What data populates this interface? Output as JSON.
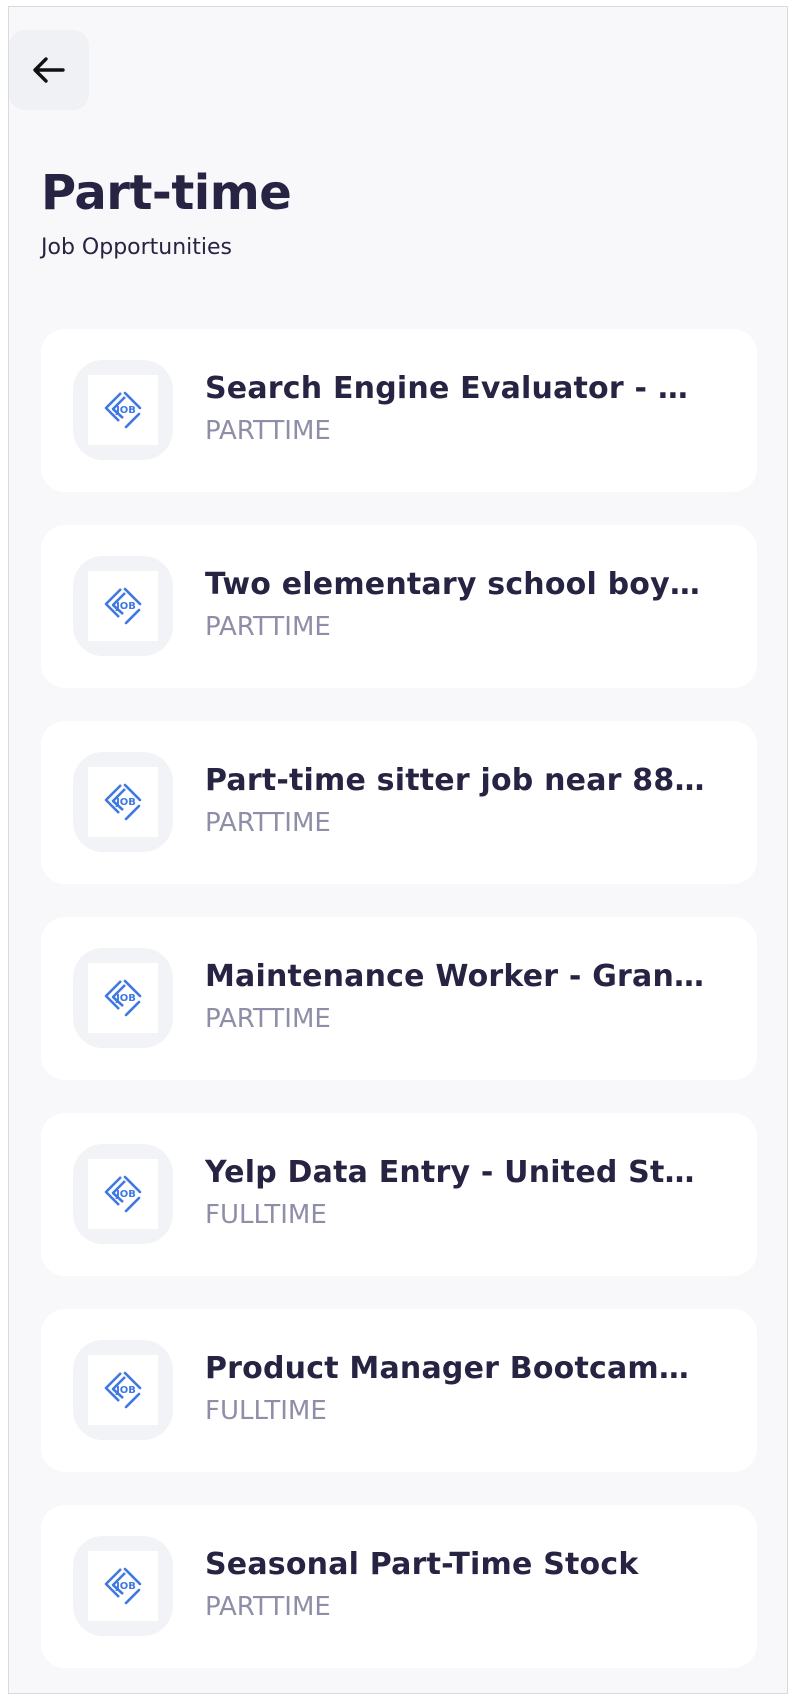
{
  "header": {
    "back_icon": "arrow-left-icon",
    "title": "Part-time",
    "subtitle": "Job Opportunities"
  },
  "jobs": [
    {
      "title": "Search Engine Evaluator - Part...",
      "type": "PARTTIME",
      "logo_text": "JOB"
    },
    {
      "title": "Two elementary school boys ...",
      "type": "PARTTIME",
      "logo_text": "JOB"
    },
    {
      "title": "Part-time sitter job near 8835...",
      "type": "PARTTIME",
      "logo_text": "JOB"
    },
    {
      "title": "Maintenance Worker - Grand ...",
      "type": "PARTTIME",
      "logo_text": "JOB"
    },
    {
      "title": "Yelp Data Entry - United State...",
      "type": "FULLTIME",
      "logo_text": "JOB"
    },
    {
      "title": "Product Manager Bootcamp a...",
      "type": "FULLTIME",
      "logo_text": "JOB"
    },
    {
      "title": "Seasonal Part-Time Stock",
      "type": "PARTTIME",
      "logo_text": "JOB"
    }
  ],
  "colors": {
    "primary_text": "#262343",
    "secondary_text": "#8f8ea8",
    "logo_accent": "#3f78e0",
    "background": "#f8f8fb",
    "card": "#ffffff"
  }
}
